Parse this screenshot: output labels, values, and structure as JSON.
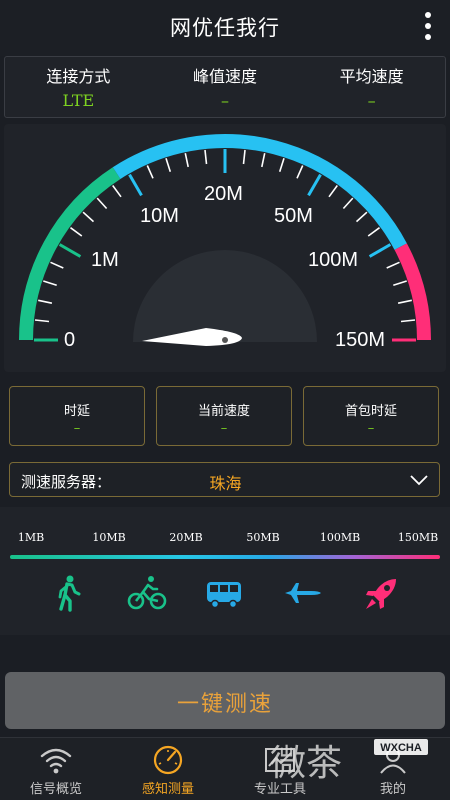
{
  "app": {
    "title": "网优任我行"
  },
  "network": [
    {
      "label": "连接方式",
      "value": "LTE"
    },
    {
      "label": "峰值速度",
      "value": "–"
    },
    {
      "label": "平均速度",
      "value": "–"
    }
  ],
  "gauge": {
    "scale_labels": [
      "0",
      "1M",
      "10M",
      "20M",
      "50M",
      "100M",
      "150M"
    ],
    "colors": {
      "green": "#19c28a",
      "blue": "#27c1f2",
      "pink": "#ff2e78"
    }
  },
  "stats": [
    {
      "label": "时延",
      "value": "–"
    },
    {
      "label": "当前速度",
      "value": "–"
    },
    {
      "label": "首包时延",
      "value": "–"
    }
  ],
  "server": {
    "label": "测速服务器：",
    "value": "珠海"
  },
  "speed_scale": [
    "1MB",
    "10MB",
    "20MB",
    "50MB",
    "100MB",
    "150MB"
  ],
  "modes": [
    {
      "icon": "walking-icon",
      "color": "#19c28a"
    },
    {
      "icon": "bicycle-icon",
      "color": "#19c28a"
    },
    {
      "icon": "bus-icon",
      "color": "#27a9e6"
    },
    {
      "icon": "airplane-icon",
      "color": "#27a9e6"
    },
    {
      "icon": "rocket-icon",
      "color": "#ff2e78"
    }
  ],
  "cta": {
    "label": "一键测速"
  },
  "tabs": [
    {
      "label": "信号概览",
      "icon": "wifi-signal-icon",
      "active": false
    },
    {
      "label": "感知测量",
      "icon": "speedometer-icon",
      "active": true
    },
    {
      "label": "专业工具",
      "icon": "chart-tool-icon",
      "active": false
    },
    {
      "label": "我的",
      "icon": "user-icon",
      "active": false
    }
  ],
  "watermark": {
    "text": "微茶",
    "badge": "WXCHA"
  }
}
